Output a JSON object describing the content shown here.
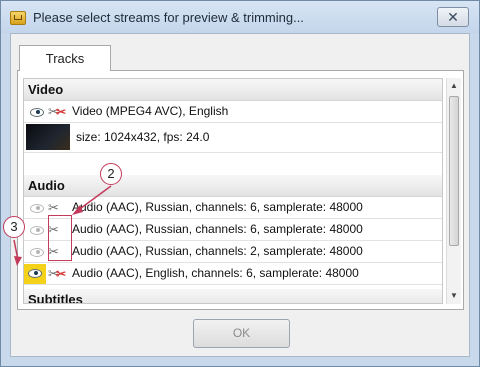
{
  "window": {
    "title": "Please select streams for preview & trimming...",
    "close_glyph": "✕"
  },
  "tabs": [
    {
      "label": "Tracks"
    }
  ],
  "video": {
    "header": "Video",
    "stream": "Video (MPEG4 AVC), English",
    "info": "size: 1024x432, fps: 24.0"
  },
  "audio": {
    "header": "Audio",
    "streams": [
      {
        "label": "Audio (AAC), Russian, channels: 6, samplerate: 48000",
        "preview": false,
        "trim": false
      },
      {
        "label": "Audio (AAC), Russian, channels: 6, samplerate: 48000",
        "preview": false,
        "trim": false
      },
      {
        "label": "Audio (AAC), Russian, channels: 2, samplerate: 48000",
        "preview": false,
        "trim": false
      },
      {
        "label": "Audio (AAC), English, channels: 6, samplerate: 48000",
        "preview": true,
        "trim": true
      }
    ]
  },
  "subtitles": {
    "header": "Subtitles"
  },
  "buttons": {
    "ok": "OK"
  },
  "callouts": {
    "trim_marker": "2",
    "preview_marker": "3"
  },
  "colors": {
    "callout": "#c23b5a",
    "highlight": "#f4d21a",
    "trim_active": "#d43333"
  }
}
